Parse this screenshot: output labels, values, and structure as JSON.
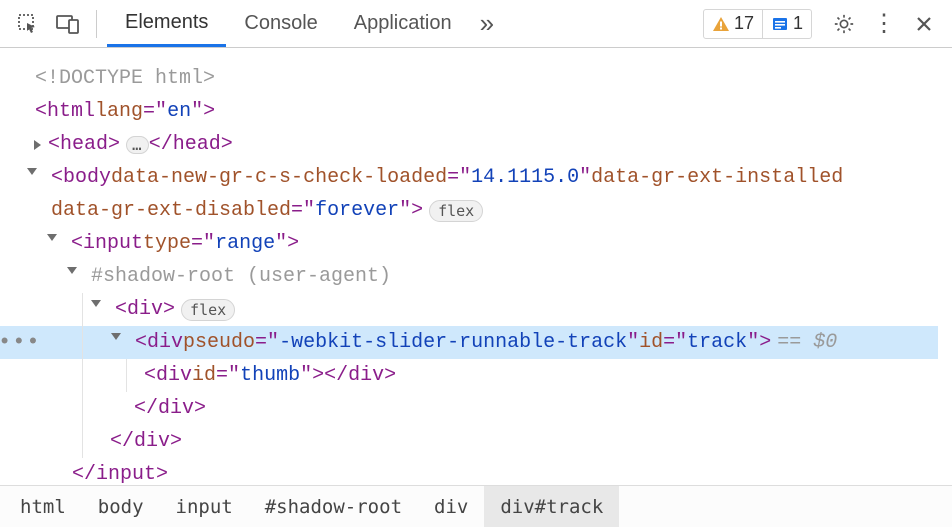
{
  "toolbar": {
    "tabs": [
      "Elements",
      "Console",
      "Application"
    ],
    "active_tab": 0,
    "warn_count": "17",
    "issue_count": "1"
  },
  "tree": {
    "l0": "<!DOCTYPE html>",
    "l1_open": "<",
    "l1_tag": "html",
    "l1_attr": " lang",
    "l1_eq": "=\"",
    "l1_val": "en",
    "l1_close": "\">",
    "l2_open": "<",
    "l2_tag": "head",
    "l2_gt": ">",
    "l2_pill": "…",
    "l2_end_open": "</",
    "l2_end": "head",
    "l2_end_close": ">",
    "l3_open": "<",
    "l3_tag": "body",
    "l3_attr1": " data-new-gr-c-s-check-loaded",
    "l3_eq1": "=\"",
    "l3_val1": "14.1115.0",
    "l3_q1c": "\"",
    "l3_attr2": " data-gr-ext-installed",
    "l3b_attr": "data-gr-ext-disabled",
    "l3b_eq": "=\"",
    "l3b_val": "forever",
    "l3b_close": "\">",
    "l3b_pill": "flex",
    "l4_open": "<",
    "l4_tag": "input",
    "l4_attr": " type",
    "l4_eq": "=\"",
    "l4_val": "range",
    "l4_close": "\">",
    "l5": "#shadow-root (user-agent)",
    "l6_open": "<",
    "l6_tag": "div",
    "l6_gt": ">",
    "l6_pill": "flex",
    "l7_open": "<",
    "l7_tag": "div",
    "l7_attr1": " pseudo",
    "l7_eq1": "=\"",
    "l7_val1": "-webkit-slider-runnable-track",
    "l7_q1c": "\"",
    "l7_attr2": " id",
    "l7_eq2": "=\"",
    "l7_val2": "track",
    "l7_close": "\">",
    "l7_eq0": "== $0",
    "l8_open": "<",
    "l8_tag": "div",
    "l8_attr": " id",
    "l8_eq": "=\"",
    "l8_val": "thumb",
    "l8_mid": "\">",
    "l8_end_open": "</",
    "l8_end": "div",
    "l8_end_close": ">",
    "l9_open": "</",
    "l9_tag": "div",
    "l9_close": ">",
    "l10_open": "</",
    "l10_tag": "div",
    "l10_close": ">",
    "l11_open": "</",
    "l11_tag": "input",
    "l11_close": ">"
  },
  "breadcrumb": [
    "html",
    "body",
    "input",
    "#shadow-root",
    "div",
    "div#track"
  ],
  "breadcrumb_active": 5
}
